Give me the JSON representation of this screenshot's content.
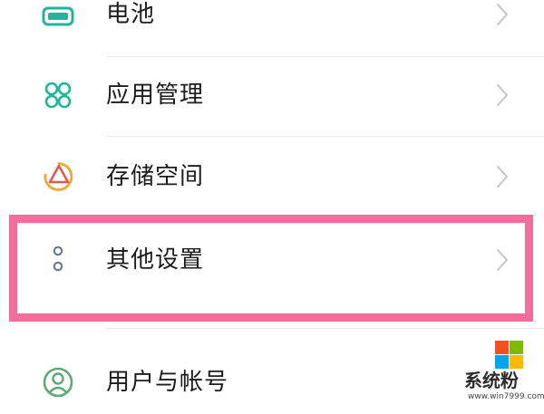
{
  "settings": {
    "items": [
      {
        "label": "电池",
        "icon": "battery-icon"
      },
      {
        "label": "应用管理",
        "icon": "apps-grid-icon"
      },
      {
        "label": "存储空间",
        "icon": "storage-pie-icon"
      },
      {
        "label": "其他设置",
        "icon": "more-dots-icon",
        "highlighted": true
      },
      {
        "label": "用户与帐号",
        "icon": "user-account-icon"
      }
    ]
  },
  "colors": {
    "icon_teal": "#1fb598",
    "icon_orange": "#f0a830",
    "icon_red": "#e05a4e",
    "icon_gray_blue": "#6b7a99",
    "icon_green": "#5aaa72",
    "highlight_border": "#f46d9b",
    "chevron": "#c4c4c4"
  },
  "watermark": {
    "text": "系统粉",
    "url": "www.win7999.com",
    "logo_colors": [
      "#f25022",
      "#7fba00",
      "#00a4ef",
      "#ffb900"
    ]
  }
}
